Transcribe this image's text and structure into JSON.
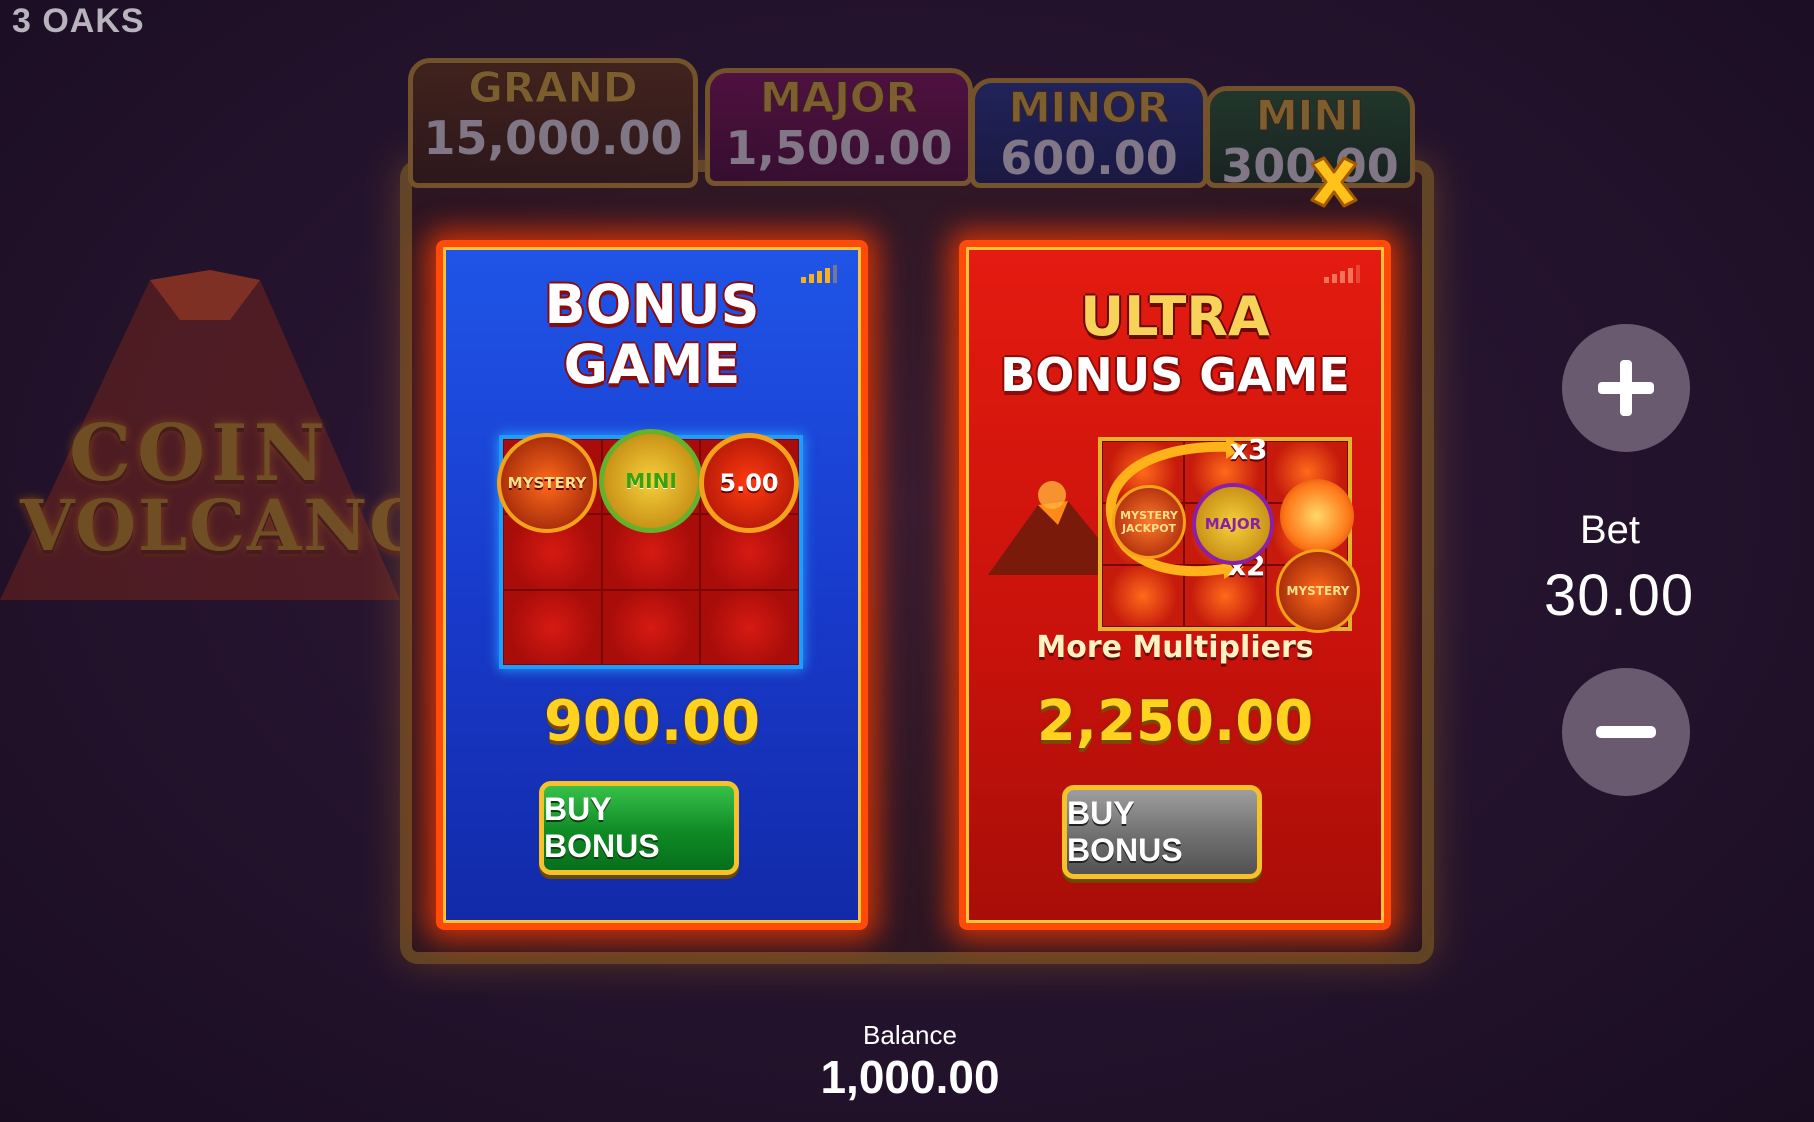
{
  "brand": "3 OAKS",
  "background": {
    "logo_line1": "COIN",
    "logo_line2": "VOLCANO",
    "jackpots": [
      {
        "name": "GRAND",
        "value": "15,000.00"
      },
      {
        "name": "MAJOR",
        "value": "1,500.00"
      },
      {
        "name": "MINOR",
        "value": "600.00"
      },
      {
        "name": "MINI",
        "value": "300.00"
      }
    ]
  },
  "modal": {
    "close_icon": "close-x-icon",
    "bonus_game": {
      "title_line1": "BONUS",
      "title_line2": "GAME",
      "coins": {
        "mystery": "MYSTERY",
        "mini": "MINI",
        "value": "5.00"
      },
      "price": "900.00",
      "buy_label": "BUY BONUS"
    },
    "ultra_bonus_game": {
      "title_line1": "ULTRA",
      "title_line2": "BONUS GAME",
      "multiplier_top": "x3",
      "multiplier_bottom": "x2",
      "coins": {
        "mystery_jackpot": "MYSTERY JACKPOT",
        "major": "MAJOR",
        "mystery": "MYSTERY"
      },
      "subtitle": "More Multipliers",
      "price": "2,250.00",
      "buy_label": "BUY BONUS"
    }
  },
  "bet": {
    "label": "Bet",
    "value": "30.00",
    "plus_icon": "plus-icon",
    "minus_icon": "minus-icon"
  },
  "balance": {
    "label": "Balance",
    "value": "1,000.00"
  },
  "colors": {
    "accent_gold": "#ffd21f",
    "bonus_blue": "#1f55e8",
    "ultra_red": "#e41b10",
    "buy_green": "#0f8a25",
    "buy_grey": "#6f6f6f"
  }
}
